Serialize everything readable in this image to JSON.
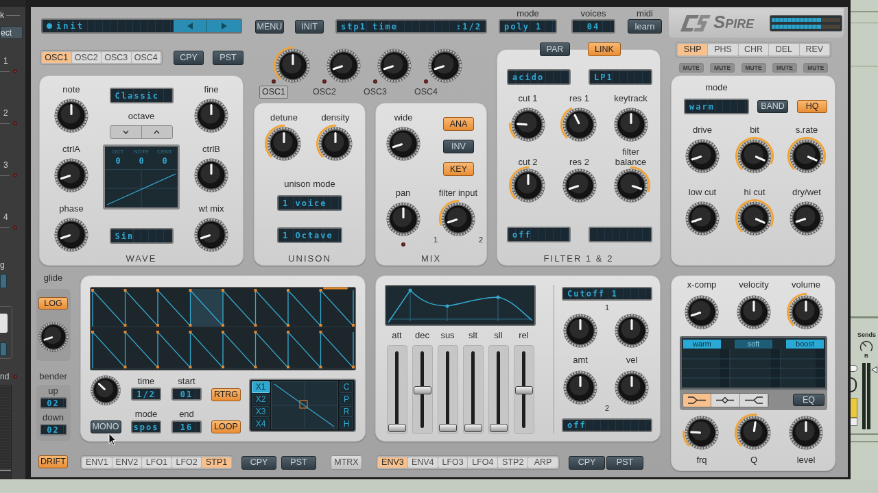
{
  "host_left": {
    "header": "k",
    "button": "ect",
    "tracks": [
      "1",
      "2",
      "3",
      "4"
    ],
    "group_label": "g",
    "bottom_label": "nd"
  },
  "top_bar": {
    "preset": "init",
    "menu_button": "MENU",
    "init_button": "INIT",
    "param_name": "stp1 time",
    "param_value": ":1/2",
    "mode": {
      "label": "mode",
      "value": "poly 1"
    },
    "voices": {
      "label": "voices",
      "value": "04"
    },
    "midi": {
      "label": "midi",
      "button": "learn"
    },
    "logo": "SPIRE"
  },
  "osc_tabs": [
    {
      "label": "OSC1",
      "selected": true
    },
    {
      "label": "OSC2",
      "selected": false
    },
    {
      "label": "OSC3",
      "selected": false
    },
    {
      "label": "OSC4",
      "selected": false
    }
  ],
  "osc_copy": "CPY",
  "osc_paste": "PST",
  "osc_levels": [
    {
      "label": "OSC1",
      "selected": true,
      "level": 0.5,
      "lit": true
    },
    {
      "label": "OSC2",
      "selected": false,
      "level": 0.1,
      "lit": false
    },
    {
      "label": "OSC3",
      "selected": false,
      "level": 0.1,
      "lit": false
    },
    {
      "label": "OSC4",
      "selected": false,
      "level": 0.1,
      "lit": false
    }
  ],
  "wave": {
    "title": "WAVE",
    "left_knobs": [
      {
        "label": "note",
        "level": 0.5,
        "lit": false
      },
      {
        "label": "ctrlA",
        "level": 0.1,
        "lit": false
      },
      {
        "label": "phase",
        "level": 0.1,
        "lit": false
      }
    ],
    "right_knobs": [
      {
        "label": "fine",
        "level": 0.5,
        "lit": false
      },
      {
        "label": "ctrlB",
        "level": 0.5,
        "lit": false
      },
      {
        "label": "wt mix",
        "level": 0.1,
        "lit": false
      }
    ],
    "type_display": "Classic",
    "octave_label": "octave",
    "screen": [
      {
        "label": "OCT",
        "value": "0"
      },
      {
        "label": "NOTE",
        "value": "0"
      },
      {
        "label": "CENT",
        "value": "0"
      }
    ],
    "wave_display": "Sin"
  },
  "unison": {
    "title": "UNISON",
    "knobs": [
      {
        "label": "detune",
        "level": 0.5,
        "lit": true
      },
      {
        "label": "density",
        "level": 0.5,
        "lit": true
      }
    ],
    "mode_label": "unison mode",
    "voices_display": "1 voice",
    "range_display": "1 Octave"
  },
  "mix": {
    "title": "MIX",
    "wide": {
      "label": "wide",
      "level": 0.1,
      "lit": false
    },
    "buttons": [
      {
        "label": "ANA",
        "on": true
      },
      {
        "label": "INV",
        "on": false
      },
      {
        "label": "KEY",
        "on": true
      }
    ],
    "pan": {
      "label": "pan",
      "level": 0.5,
      "lit": false
    },
    "filter_input": {
      "label": "filter input",
      "kind": "bipolar",
      "level": 0.1,
      "lit": true
    },
    "input_marks": [
      "1",
      "2"
    ]
  },
  "filter": {
    "title": "FILTER 1 & 2",
    "routing": [
      {
        "label": "PAR",
        "on": false
      },
      {
        "label": "LINK",
        "on": true
      }
    ],
    "type_displays": [
      "acido",
      "LP1"
    ],
    "knobs": [
      {
        "label": "cut 1",
        "kind": "unipolar",
        "level": 0.18,
        "lit": true
      },
      {
        "label": "res 1",
        "kind": "unipolar",
        "level": 0.4,
        "lit": true
      },
      {
        "label": "keytrack",
        "level": 0.5,
        "lit": false
      },
      {
        "label": "cut 2",
        "kind": "unipolar",
        "level": 0.5,
        "lit": true
      },
      {
        "label": "res 2",
        "level": 0.1,
        "lit": false
      },
      {
        "label": "filter balance",
        "kind": "bipolar",
        "level": 0.9,
        "lit": true
      }
    ],
    "bottom_display": "off"
  },
  "fx": {
    "tabs": [
      {
        "label": "SHP",
        "selected": true
      },
      {
        "label": "PHS",
        "selected": false
      },
      {
        "label": "CHR",
        "selected": false
      },
      {
        "label": "DEL",
        "selected": false
      },
      {
        "label": "REV",
        "selected": false
      }
    ],
    "mutes": [
      {
        "label": "MUTE",
        "on": false
      },
      {
        "label": "MUTE",
        "on": false
      },
      {
        "label": "MUTE",
        "on": false
      },
      {
        "label": "MUTE",
        "on": false
      },
      {
        "label": "MUTE",
        "on": false
      }
    ],
    "mode_label": "mode",
    "mode_display": "warm",
    "buttons": [
      {
        "label": "BAND",
        "on": false
      },
      {
        "label": "HQ",
        "on": true
      }
    ],
    "knobs": [
      {
        "label": "drive",
        "level": 0.1,
        "lit": false
      },
      {
        "label": "bit",
        "level": 0.92,
        "lit": true
      },
      {
        "label": "s.rate",
        "level": 0.92,
        "lit": true
      },
      {
        "label": "low cut",
        "level": 0.1,
        "lit": false
      },
      {
        "label": "hi cut",
        "level": 0.92,
        "lit": true
      },
      {
        "label": "dry/wet",
        "level": 0.1,
        "lit": false
      }
    ]
  },
  "glide": {
    "label": "glide",
    "log": {
      "label": "LOG",
      "on": true
    },
    "knob": {
      "level": 0.1,
      "lit": false
    },
    "bender_label": "bender",
    "up_label": "up",
    "up_value": "02",
    "down_label": "down",
    "down_value": "02",
    "drift": {
      "label": "DRIFT",
      "on": true
    }
  },
  "step": {
    "knob": {
      "level": 0.33,
      "lit": false
    },
    "mono": {
      "label": "MONO",
      "on": false
    },
    "fields": [
      {
        "label": "time",
        "value": "1/2"
      },
      {
        "label": "start",
        "value": "01"
      },
      {
        "label": "mode",
        "value": "spos"
      },
      {
        "label": "end",
        "value": "16"
      }
    ],
    "toggles": [
      {
        "label": "RTRG",
        "on": true
      },
      {
        "label": "LOOP",
        "on": true
      }
    ],
    "slots": [
      {
        "label": "X1",
        "selected": true
      },
      {
        "label": "X2",
        "selected": false
      },
      {
        "label": "X3",
        "selected": false
      },
      {
        "label": "X4",
        "selected": false
      }
    ],
    "modes": [
      {
        "label": "C",
        "selected": false
      },
      {
        "label": "P",
        "selected": false
      },
      {
        "label": "R",
        "selected": false
      },
      {
        "label": "H",
        "selected": false
      }
    ]
  },
  "mod_tabs_left": [
    {
      "label": "ENV1",
      "selected": false
    },
    {
      "label": "ENV2",
      "selected": false
    },
    {
      "label": "LFO1",
      "selected": false
    },
    {
      "label": "LFO2",
      "selected": false
    },
    {
      "label": "STP1",
      "selected": true
    }
  ],
  "left_copy": "CPY",
  "left_paste": "PST",
  "matrix_button": {
    "label": "MTRX",
    "on": false
  },
  "env": {
    "sliders": [
      {
        "label": "att",
        "level": 0
      },
      {
        "label": "dec",
        "level": 0.5
      },
      {
        "label": "sus",
        "level": 0
      },
      {
        "label": "slt",
        "level": 0
      },
      {
        "label": "sll",
        "level": 0
      },
      {
        "label": "rel",
        "level": 0.5
      }
    ],
    "target_display": "Cutoff 1",
    "marks": [
      "1",
      "2"
    ],
    "columns": [
      {
        "label": "amt",
        "knob_1": {
          "level": 0.5,
          "lit": false
        },
        "knob_2": {
          "level": 0.5,
          "lit": false
        }
      },
      {
        "label": "vel",
        "knob_1": {
          "level": 0.5,
          "lit": false
        },
        "knob_2": {
          "level": 0.5,
          "lit": false
        }
      }
    ],
    "source_display": "off"
  },
  "mod_tabs_right": [
    {
      "label": "ENV3",
      "selected": true
    },
    {
      "label": "ENV4",
      "selected": false
    },
    {
      "label": "LFO3",
      "selected": false
    },
    {
      "label": "LFO4",
      "selected": false
    },
    {
      "label": "STP2",
      "selected": false
    },
    {
      "label": "ARP",
      "selected": false
    }
  ],
  "right_copy": "CPY",
  "right_paste": "PST",
  "output": {
    "knobs": [
      {
        "label": "x-comp",
        "level": 0.1,
        "lit": false
      },
      {
        "label": "velocity",
        "level": 0.5,
        "lit": false
      },
      {
        "label": "volume",
        "level": 0.5,
        "lit": true
      }
    ],
    "eq_modes": [
      {
        "label": "warm",
        "on": true
      },
      {
        "label": "soft",
        "on": false
      },
      {
        "label": "boost",
        "on": true
      }
    ],
    "eq_shapes": [
      {
        "kind": "low_shelf",
        "selected": true
      },
      {
        "kind": "peak",
        "selected": false
      },
      {
        "kind": "high_shelf",
        "selected": false
      }
    ],
    "eq_button": {
      "label": "EQ",
      "on": false
    },
    "eq_knobs": [
      {
        "label": "frq",
        "level": 0.18,
        "lit": true
      },
      {
        "label": "Q",
        "level": 0.53,
        "lit": true
      },
      {
        "label": "level",
        "level": 0.5,
        "lit": false
      }
    ]
  },
  "host_right": {
    "label": "Sends",
    "knob_label": "B"
  }
}
